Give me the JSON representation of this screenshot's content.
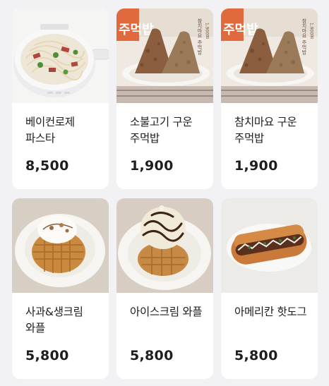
{
  "menu": {
    "items": [
      {
        "name": "베이컨로제 파스타",
        "price": "8,500",
        "image": "bacon-rose-pasta-photo"
      },
      {
        "name": "소불고기 구운 주먹밥",
        "price": "1,900",
        "image": "bulgogi-grilled-rice-ball-photo",
        "photo_sign": {
          "big": "주먹밥",
          "vertical": "참치마요 주먹밥",
          "price": "1,900원"
        }
      },
      {
        "name": "참치마요 구운 주먹밥",
        "price": "1,900",
        "image": "tuna-mayo-grilled-rice-ball-photo",
        "photo_sign": {
          "big": "주먹밥",
          "vertical": "참치마요 주먹밥",
          "price": "1,900원"
        }
      },
      {
        "name": "사과&생크림 와플",
        "price": "5,800",
        "image": "apple-cream-waffle-photo"
      },
      {
        "name": "아이스크림 와플",
        "price": "5,800",
        "image": "icecream-waffle-photo"
      },
      {
        "name": "아메리칸 핫도그",
        "price": "5,800",
        "image": "american-hotdog-photo"
      }
    ]
  }
}
